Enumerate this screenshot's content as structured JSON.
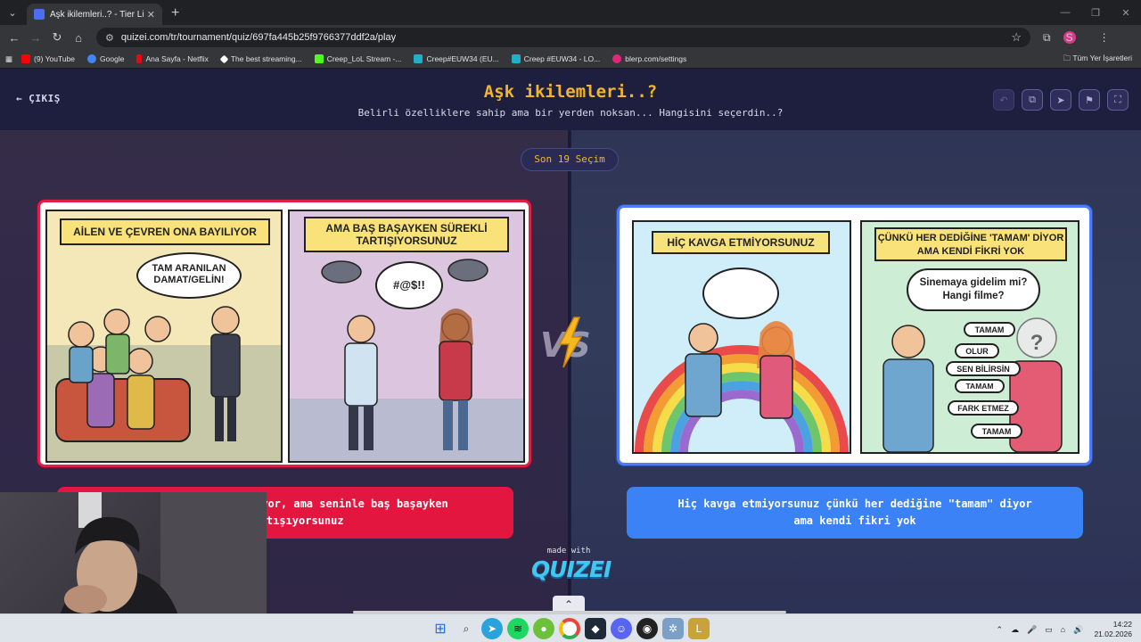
{
  "browser": {
    "tab_title": "Aşk ikilemleri..? - Tier List, Kör S",
    "url": "quizei.com/tr/tournament/quiz/697fa445b25f9766377ddf2a/play",
    "bookmarks": [
      {
        "label": "(9) YouTube",
        "color": "#ff0000"
      },
      {
        "label": "Google",
        "color": "#4285f4"
      },
      {
        "label": "Ana Sayfa - Netflix",
        "color": "#e50914"
      },
      {
        "label": "The best streaming...",
        "color": "#ffffff"
      },
      {
        "label": "Creep_LoL Stream -...",
        "color": "#53fc18"
      },
      {
        "label": "Creep#EUW34 (EU...",
        "color": "#1fb0c9"
      },
      {
        "label": "Creep #EUW34 - LO...",
        "color": "#1fb0c9"
      },
      {
        "label": "blerp.com/settings",
        "color": "#e0287a"
      }
    ],
    "all_bookmarks": "Tüm Yer İşaretleri",
    "profile_initial": "S"
  },
  "app": {
    "exit_label": "ÇIKIŞ",
    "title": "Aşk ikilemleri..?",
    "subtitle": "Belirli özelliklere sahip ama bir yerden noksan... Hangisini seçerdin..?",
    "round_label": "Son 19 Seçim",
    "left": {
      "panel1_banner": "AİLEN VE ÇEVREN ONA BAYILIYOR",
      "panel1_bubble": "TAM ARANILAN DAMAT/GELİN!",
      "panel2_banner": "AMA BAŞ BAŞAYKEN SÜREKLİ TARTIŞIYORSUNUZ",
      "panel2_bubble": "#@$!!",
      "choice_line1": "yor, ama seninle baş başayken",
      "choice_line2": "artışıyorsunuz"
    },
    "right": {
      "panel1_banner": "HİÇ KAVGA ETMİYORSUNUZ",
      "panel2_banner": "ÇÜNKÜ HER DEDİĞİNE 'TAMAM' DİYOR AMA KENDİ FİKRİ YOK",
      "speech": "Sinemaya gidelim mi? Hangi filme?",
      "answers": [
        "TAMAM",
        "OLUR",
        "SEN BİLİRSİN",
        "TAMAM",
        "FARK ETMEZ",
        "TAMAM"
      ],
      "face": "?",
      "choice_line1": "Hiç kavga etmiyorsunuz çünkü her dediğine \"tamam\" diyor",
      "choice_line2": "ama kendi fikri yok"
    },
    "made_with": "made with",
    "logo": "QUIZEI"
  },
  "taskbar": {
    "time": "14:22",
    "date": "21.02.2026"
  },
  "colors": {
    "accent": "#f3b52f",
    "left_choice": "#e3163f",
    "right_choice": "#3b82f6"
  }
}
